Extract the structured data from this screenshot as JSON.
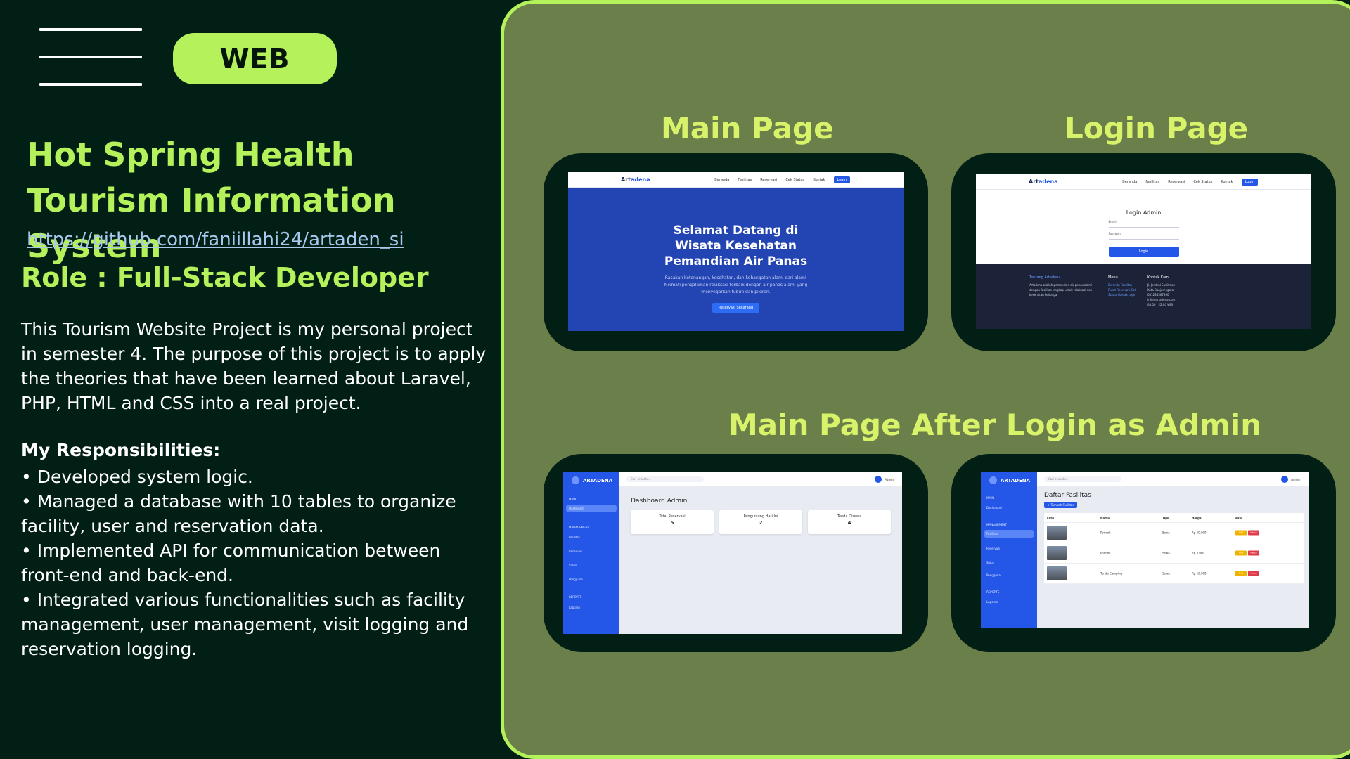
{
  "badge": {
    "label": "WEB"
  },
  "project": {
    "title": "Hot Spring Health Tourism Information System",
    "repo_url": "https://github.com/faniillahi24/artaden_si",
    "role": "Role : Full-Stack Developer",
    "description": "This Tourism Website Project is my personal project in semester 4. The purpose of this project is to apply the theories that have been learned about Laravel, PHP, HTML and CSS into a real project."
  },
  "responsibilities": {
    "title": "My Responsibilities:",
    "items": [
      "• Developed system logic.",
      "• Managed a database with 10 tables to organize facility, user and reservation data.",
      "• Implemented API for communication between front-end and back-end.",
      "• Integrated various functionalities such as facility management, user management, visit logging and reservation logging."
    ]
  },
  "sections": {
    "main_page": "Main Page",
    "login_page": "Login Page",
    "admin_page": "Main Page After Login as Admin"
  },
  "site": {
    "brand_a": "Art",
    "brand_b": "adena",
    "nav": [
      "Beranda",
      "Fasilitas",
      "Reservasi",
      "Cek Status",
      "Kontak"
    ],
    "login_btn": "Login",
    "hero_title": "Selamat Datang di Wisata Kesehatan Pemandian Air Panas",
    "hero_text": "Rasakan ketenangan, kesehatan, dan kehangatan alami dari alam! Nikmati pengalaman relaksasi terbaik dengan air panas alami yang menyegarkan tubuh dan pikiran.",
    "hero_cta": "Reservasi Sekarang",
    "login_title": "Login Admin",
    "login_email": "Email",
    "login_password": "Password",
    "login_submit": "Login",
    "footer_about_title": "Tentang Artadena",
    "footer_about_text": "Artadena adalah pemandian air panas alami dengan fasilitas lengkap untuk relaksasi dan kesehatan keluarga.",
    "footer_menu_title": "Menu",
    "footer_menu": [
      "Beranda Fasilitas",
      "Pusat Reservasi Cek",
      "Status Kontak Login"
    ],
    "footer_contact_title": "Kontak Kami",
    "footer_contact": [
      "Jl. Jendral Sudirman",
      "Kota Banjarnegara",
      "081234567890",
      "info@artadena.com",
      "08.00 - 22.00 WIB"
    ]
  },
  "admin": {
    "brand": "ARTADENA",
    "search": "Cari sesuatu...",
    "user": "Admin",
    "menu": [
      "MAIN",
      "Dashboard",
      "MANAGEMENT",
      "Fasilitas",
      "Reservasi",
      "Saluri",
      "Pengguna",
      "REPORTS",
      "Laporan"
    ],
    "dashboard_title": "Dashboard Admin",
    "cards": [
      {
        "label": "Total Reservasi",
        "value": "5"
      },
      {
        "label": "Pengunjung Hari Ini",
        "value": "2"
      },
      {
        "label": "Tenda Disewa",
        "value": "4"
      }
    ],
    "fac_title": "Daftar Fasilitas",
    "fac_add": "+ Tambah Fasilitas",
    "fac_headers": [
      "Foto",
      "Nama",
      "Tipe",
      "Harga",
      "Aksi"
    ],
    "fac_rows": [
      {
        "name": "Pondok",
        "type": "Sewa",
        "price": "Rp 50.000"
      },
      {
        "name": "Pondok",
        "type": "Sewa",
        "price": "Rp 5.000"
      },
      {
        "name": "Tenda Camping",
        "type": "Sewa",
        "price": "Rp 10.000"
      }
    ],
    "edit": "Edit",
    "delete": "Hapus"
  },
  "colors": {
    "accent": "#b4f15a",
    "panel": "#6b7f4a",
    "dark": "#021f15",
    "label": "#d8f36a"
  }
}
